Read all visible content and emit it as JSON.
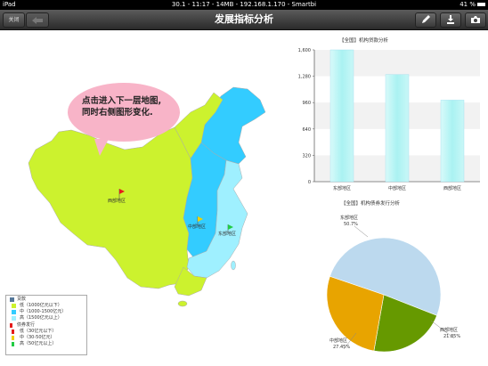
{
  "status_bar": {
    "device": "iPad",
    "info": "30.1 - 11:17 - 14MB - 192.168.1.170 - Smartbi",
    "battery": "41 %"
  },
  "nav": {
    "title": "发展指标分析",
    "close_label": "关闭",
    "icons": [
      "pencil-icon",
      "download-icon",
      "camera-icon"
    ]
  },
  "callout": {
    "text": "点击进入下一层地图,同时右侧图形变化."
  },
  "map": {
    "regions": [
      {
        "label": "西部地区",
        "fill": "#ccf22e"
      },
      {
        "label": "中部地区",
        "fill": "#33ccff"
      },
      {
        "label": "东部地区",
        "fill": "#9ff0ff"
      }
    ]
  },
  "legend": {
    "title_loans": "贷款",
    "loans": [
      {
        "label": "低（1000亿元以下）",
        "color": "#ccf22e"
      },
      {
        "label": "中（1000-1500亿元）",
        "color": "#33ccff"
      },
      {
        "label": "高（1500亿元以上）",
        "color": "#9ff0ff"
      }
    ],
    "title_bonds": "债券发行",
    "bonds": [
      {
        "label": "低（30亿元以下）",
        "color": "#e51c1c"
      },
      {
        "label": "中（30-50亿元）",
        "color": "#f0d000"
      },
      {
        "label": "高（50亿元以上）",
        "color": "#22cc44"
      }
    ]
  },
  "chart_data": [
    {
      "type": "bar",
      "title": "【全国】机构贷款分析",
      "categories": [
        "东部地区",
        "中部地区",
        "西部地区"
      ],
      "values": [
        1600,
        1300,
        990
      ],
      "ylim": [
        0,
        1600
      ],
      "yticks": [
        "0",
        "320",
        "640",
        "960",
        "1,280",
        "1,600"
      ],
      "color": "#aaf2f2"
    },
    {
      "type": "pie",
      "title": "【全国】机构债券发行分析",
      "slices": [
        {
          "label": "东部地区",
          "value": 50.7,
          "display": "50.7%",
          "color": "#bcd9ee"
        },
        {
          "label": "西部地区",
          "value": 21.85,
          "display": "21.85%",
          "color": "#669900"
        },
        {
          "label": "中部地区",
          "value": 27.45,
          "display": "27.45%",
          "color": "#e8a400"
        }
      ]
    }
  ]
}
